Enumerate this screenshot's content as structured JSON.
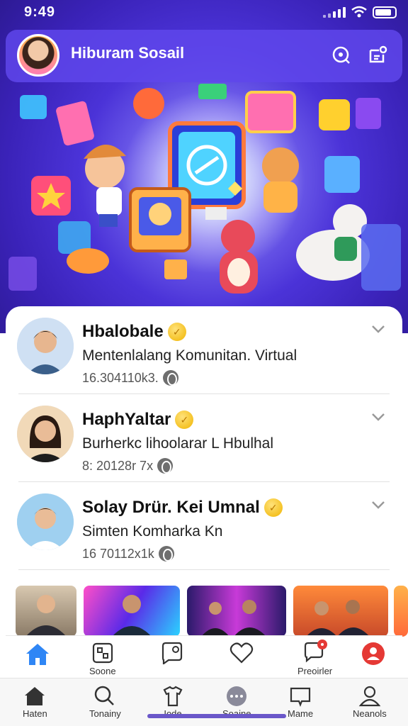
{
  "status_bar": {
    "time": "9:49"
  },
  "header": {
    "title": "Hiburam Sosail",
    "search_icon": "search-icon",
    "chat_icon": "chat-user-icon"
  },
  "colors": {
    "primary": "#4b33d8",
    "accent_blue": "#2f86f5",
    "badge_gold": "#f0b400",
    "notify_red": "#e53935"
  },
  "posts": [
    {
      "name": "Hbalobale",
      "subtitle": "Mentenlalang Komunitan. Virtual",
      "meta": "16.304110k3."
    },
    {
      "name": "HaphYaltar",
      "subtitle": "Burherkc lihoolarar L Hbulhal",
      "meta": "8: 20128r 7x"
    },
    {
      "name": "Solay Drür. Kei Umnal",
      "subtitle": "Simten Komharka Kn",
      "meta": "16 70112x1k"
    }
  ],
  "nav_top": [
    {
      "label": "",
      "icon": "home-icon"
    },
    {
      "label": "Soone",
      "icon": "scan-icon"
    },
    {
      "label": "",
      "icon": "chat-bubble-icon"
    },
    {
      "label": "",
      "icon": "heart-icon"
    },
    {
      "label": "Preoirler",
      "icon": "notification-icon"
    },
    {
      "label": "",
      "icon": "profile-red-icon"
    }
  ],
  "nav_bottom": [
    {
      "label": "Haten",
      "icon": "house-icon"
    },
    {
      "label": "Tonainy",
      "icon": "search-icon"
    },
    {
      "label": "Iode",
      "icon": "shirt-icon"
    },
    {
      "label": "Soaine",
      "icon": "more-icon"
    },
    {
      "label": "Mame",
      "icon": "message-icon"
    },
    {
      "label": "Neanols",
      "icon": "user-icon"
    }
  ]
}
